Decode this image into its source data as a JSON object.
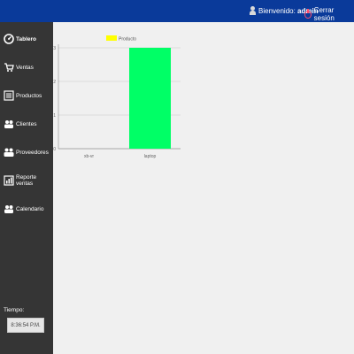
{
  "header": {
    "welcome_prefix": "Bienvenido:",
    "username": "admin",
    "logout_label": "Cerrar sesión",
    "bg_color": "#0a3a9a"
  },
  "sidebar": {
    "items": [
      {
        "label": "Tablero",
        "icon": "dashboard-icon",
        "active": true
      },
      {
        "label": "Ventas",
        "icon": "cart-icon"
      },
      {
        "label": "Productos",
        "icon": "list-icon"
      },
      {
        "label": "Clientes",
        "icon": "clients-icon"
      },
      {
        "label": "Proveedores",
        "icon": "suppliers-icon"
      },
      {
        "label": "Reporte ventas",
        "icon": "report-icon"
      },
      {
        "label": "Calendario",
        "icon": "calendar-icon"
      }
    ],
    "time_label": "Tiempo:",
    "clock_value": "8:36:54 P.M.",
    "bg_color": "#353535"
  },
  "chart_data": {
    "type": "bar",
    "categories": [
      "xb-vr",
      "laptop"
    ],
    "series": [
      {
        "name": "Producto",
        "values": [
          0,
          3
        ],
        "color": "#00ff66"
      }
    ],
    "legend_swatch_color": "#ffff00",
    "legend_position": "top-left",
    "ylim": [
      0,
      3
    ],
    "yticks": [
      0,
      1,
      2,
      3
    ],
    "grid": true,
    "title": "",
    "xlabel": "",
    "ylabel": ""
  }
}
